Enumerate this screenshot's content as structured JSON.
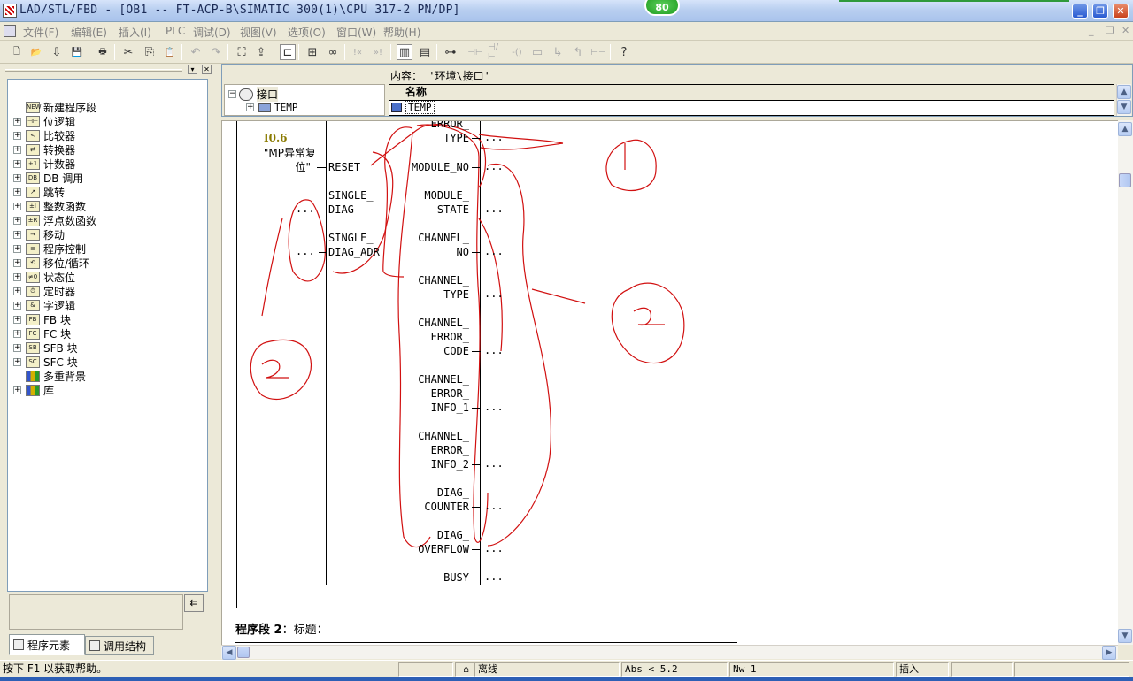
{
  "window": {
    "title": "LAD/STL/FBD  - [OB1 -- FT-ACP-B\\SIMATIC 300(1)\\CPU 317-2 PN/DP]",
    "badge": "80",
    "buttons": {
      "minimize": "_",
      "restore": "❐",
      "close": "✕"
    }
  },
  "menu": {
    "items": [
      "文件(F)",
      "编辑(E)",
      "插入(I)",
      "PLC",
      "调试(D)",
      "视图(V)",
      "选项(O)",
      "窗口(W)",
      "帮助(H)"
    ],
    "mdi_controls": [
      "_",
      "❐",
      "✕"
    ]
  },
  "toolbar": {
    "buttons": [
      {
        "name": "new-icon",
        "glyph": "🗋"
      },
      {
        "name": "open-icon",
        "glyph": "📂"
      },
      {
        "name": "download-icon",
        "glyph": "⇩"
      },
      {
        "name": "save-icon",
        "glyph": "💾"
      },
      {
        "name": "print-icon",
        "glyph": "🖶"
      },
      {
        "name": "cut-icon",
        "glyph": "✂"
      },
      {
        "name": "copy-icon",
        "glyph": "⎘"
      },
      {
        "name": "paste-icon",
        "glyph": "📋"
      },
      {
        "name": "undo-icon",
        "glyph": "↶"
      },
      {
        "name": "redo-icon",
        "glyph": "↷"
      },
      {
        "name": "accessible-nodes-icon",
        "glyph": "⛶"
      },
      {
        "name": "load-to-pg-icon",
        "glyph": "⇪"
      },
      {
        "name": "monitor-icon",
        "glyph": "⊏"
      },
      {
        "name": "network-icon",
        "glyph": "⊞"
      },
      {
        "name": "glasses-icon",
        "glyph": "∞"
      },
      {
        "name": "prev-icon",
        "glyph": "!«"
      },
      {
        "name": "next-icon",
        "glyph": "»!"
      },
      {
        "name": "overview-icon",
        "glyph": "▥"
      },
      {
        "name": "details-icon",
        "glyph": "▤"
      },
      {
        "name": "network-ladder-icon",
        "glyph": "⊶"
      },
      {
        "name": "no-contact-icon",
        "glyph": "⊣⊢"
      },
      {
        "name": "nc-contact-icon",
        "glyph": "⊣/⊢"
      },
      {
        "name": "coil-icon",
        "glyph": "-()"
      },
      {
        "name": "empty-box-icon",
        "glyph": "▭"
      },
      {
        "name": "branch-open-icon",
        "glyph": "↳"
      },
      {
        "name": "branch-close-icon",
        "glyph": "↰"
      },
      {
        "name": "connection-icon",
        "glyph": "⊢⊣"
      },
      {
        "name": "help-icon",
        "glyph": "?"
      }
    ]
  },
  "left_panel": {
    "tree": [
      {
        "label": "新建程序段",
        "icon": "new-network-icon",
        "expandable": false,
        "glyph": "NEW"
      },
      {
        "label": "位逻辑",
        "icon": "bit-logic-icon",
        "expandable": true,
        "glyph": "⊣⊢"
      },
      {
        "label": "比较器",
        "icon": "comparator-icon",
        "expandable": true,
        "glyph": "<"
      },
      {
        "label": "转换器",
        "icon": "converter-icon",
        "expandable": true,
        "glyph": "⇄"
      },
      {
        "label": "计数器",
        "icon": "counter-icon",
        "expandable": true,
        "glyph": "+1"
      },
      {
        "label": "DB 调用",
        "icon": "db-call-icon",
        "expandable": true,
        "glyph": "DB"
      },
      {
        "label": "跳转",
        "icon": "jump-icon",
        "expandable": true,
        "glyph": "↗"
      },
      {
        "label": "整数函数",
        "icon": "integer-function-icon",
        "expandable": true,
        "glyph": "±I"
      },
      {
        "label": "浮点数函数",
        "icon": "float-function-icon",
        "expandable": true,
        "glyph": "±R"
      },
      {
        "label": "移动",
        "icon": "move-icon",
        "expandable": true,
        "glyph": "→"
      },
      {
        "label": "程序控制",
        "icon": "program-control-icon",
        "expandable": true,
        "glyph": "≡"
      },
      {
        "label": "移位/循环",
        "icon": "shift-rotate-icon",
        "expandable": true,
        "glyph": "⟲"
      },
      {
        "label": "状态位",
        "icon": "status-bits-icon",
        "expandable": true,
        "glyph": "≠0"
      },
      {
        "label": "定时器",
        "icon": "timer-icon",
        "expandable": true,
        "glyph": "⏱"
      },
      {
        "label": "字逻辑",
        "icon": "word-logic-icon",
        "expandable": true,
        "glyph": "&"
      },
      {
        "label": "FB 块",
        "icon": "fb-block-icon",
        "expandable": true,
        "glyph": "FB"
      },
      {
        "label": "FC 块",
        "icon": "fc-block-icon",
        "expandable": true,
        "glyph": "FC"
      },
      {
        "label": "SFB 块",
        "icon": "sfb-block-icon",
        "expandable": true,
        "glyph": "SB"
      },
      {
        "label": "SFC 块",
        "icon": "sfc-block-icon",
        "expandable": true,
        "glyph": "SC"
      },
      {
        "label": "多重背景",
        "icon": "multi-instance-icon",
        "expandable": false,
        "glyph": "▥"
      },
      {
        "label": "库",
        "icon": "library-icon",
        "expandable": true,
        "glyph": "▥"
      }
    ],
    "tabs": [
      {
        "label": "程序元素",
        "active": true
      },
      {
        "label": "调用结构",
        "active": false
      }
    ],
    "corner_button": "⇇"
  },
  "interface": {
    "contents_label": "内容： '环境\\接口'",
    "tree_root": "接口",
    "tree_child": "TEMP",
    "column_header": "名称",
    "row": "TEMP"
  },
  "network": {
    "address": "I0.6",
    "symbol_line1": "\"MP异常复",
    "symbol_line2": "位\"",
    "inputs": [
      {
        "label": "RESET",
        "connected": "symbol"
      },
      {
        "label": "SINGLE_\nDIAG",
        "connected": "..."
      },
      {
        "label": "SINGLE_\nDIAG_ADR",
        "connected": "..."
      }
    ],
    "outputs": [
      {
        "label": "ERROR_\nTYPE"
      },
      {
        "label": "MODULE_NO"
      },
      {
        "label": "MODULE_\nSTATE"
      },
      {
        "label": "CHANNEL_\nNO"
      },
      {
        "label": "CHANNEL_\nTYPE"
      },
      {
        "label": "CHANNEL_\nERROR_\nCODE"
      },
      {
        "label": "CHANNEL_\nERROR_\nINFO_1"
      },
      {
        "label": "CHANNEL_\nERROR_\nINFO_2"
      },
      {
        "label": "DIAG_\nCOUNTER"
      },
      {
        "label": "DIAG_\nOVERFLOW"
      },
      {
        "label": "BUSY"
      }
    ],
    "dots": "...",
    "segment2_label": "程序段 2",
    "segment2_title": "：标题：",
    "annotation_color": "#d11010"
  },
  "statusbar": {
    "help": "按下 F1 以获取帮助。",
    "mode": "离线",
    "abs": "Abs < 5.2",
    "nw": "Nw 1",
    "insert": "插入"
  }
}
